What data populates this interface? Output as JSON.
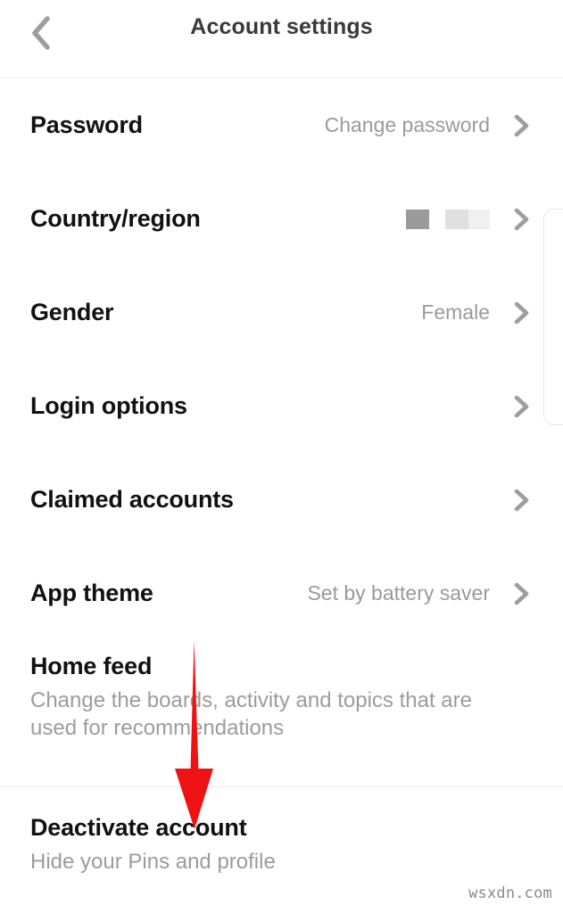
{
  "header": {
    "title": "Account settings",
    "back_icon": "chevron-left-icon"
  },
  "settings": {
    "rows": [
      {
        "label": "Password",
        "value": "Change password",
        "chevron": "chevron-right-icon"
      },
      {
        "label": "Country/region",
        "value": "",
        "redacted": true,
        "chevron": "chevron-right-icon"
      },
      {
        "label": "Gender",
        "value": "Female",
        "chevron": "chevron-right-icon"
      },
      {
        "label": "Login options",
        "value": "",
        "chevron": "chevron-right-icon"
      },
      {
        "label": "Claimed accounts",
        "value": "",
        "chevron": "chevron-right-icon"
      },
      {
        "label": "App theme",
        "value": "Set by battery saver",
        "chevron": "chevron-right-icon"
      }
    ],
    "home_feed": {
      "label": "Home feed",
      "subtitle": "Change the boards, activity and topics that are used for recommendations"
    },
    "deactivate": {
      "label": "Deactivate account",
      "subtitle": "Hide your Pins and profile"
    }
  },
  "annotation": {
    "arrow_icon": "down-arrow-annotation",
    "color": "#ef1212"
  },
  "watermark": {
    "text": "wsxdn.com"
  },
  "colors": {
    "background": "#ffffff",
    "label": "#111111",
    "value": "#9a9a9a",
    "divider": "#ececec",
    "chevron": "#9e9e9e",
    "accent_red": "#ef1212"
  }
}
